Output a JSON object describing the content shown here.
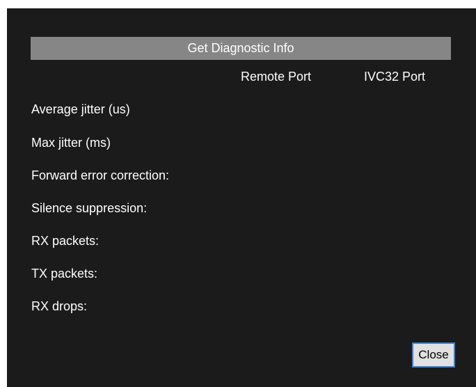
{
  "dialog": {
    "diagnostic_button_label": "Get Diagnostic Info",
    "columns": {
      "remote_port": "Remote Port",
      "ivc32_port": "IVC32 Port"
    },
    "rows": [
      {
        "label": "Average jitter (us)"
      },
      {
        "label": "Max jitter (ms)"
      },
      {
        "label": "Forward error correction:"
      },
      {
        "label": "Silence suppression:"
      },
      {
        "label": "RX packets:"
      },
      {
        "label": "TX packets:"
      },
      {
        "label": "RX drops:"
      }
    ],
    "close_label": "Close"
  },
  "colors": {
    "background": "#1b1b1b",
    "button_gray": "#868686",
    "close_border": "#3d7fd6"
  }
}
